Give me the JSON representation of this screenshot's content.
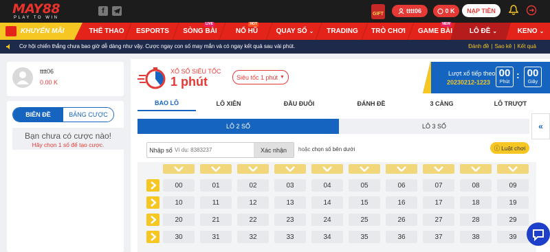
{
  "brand": {
    "name": "MAY88",
    "tagline": "PLAY TO WIN"
  },
  "header": {
    "gift_label": "GIFT",
    "username": "tttt06",
    "balance": "0 K",
    "deposit_label": "NẠP TIỀN"
  },
  "nav": {
    "promo": "KHUYẾN MÃI",
    "items": [
      "THỂ THAO",
      "ESPORTS",
      "SÒNG BÀI",
      "NỔ HŨ",
      "QUAY SỐ",
      "TRADING",
      "TRÒ CHƠI",
      "GAME BÀI",
      "LÔ ĐỀ",
      "KENO"
    ],
    "badges": {
      "live": "LIVE",
      "hot": "HOT",
      "new": "NEW"
    }
  },
  "ticker": {
    "message": "Cơ hội chiến thắng chưa bao giờ dễ dàng như vậy. Cược ngay con số may mắn và có ngay kết quả sau vài phút.",
    "links": [
      "Đánh đề",
      "Sao kê",
      "Kết quả"
    ]
  },
  "user_panel": {
    "username": "tttt06",
    "balance": "0.00 K"
  },
  "slip": {
    "tab_active": "BIÊN ĐỀ",
    "tab_other": "BẢNG CƯỢC",
    "empty_title": "Bạn chưa có cược nào!",
    "empty_hint": "Hãy chọn 1 số để tạo cược."
  },
  "game": {
    "name": "XỔ SỐ SIÊU TỐC",
    "duration": "1 phút",
    "speed_select": "Siêu tốc 1 phút",
    "next_label": "Lượt xổ tiếp theo",
    "draw_id": "20230212-1223",
    "minutes": "00",
    "minutes_unit": "Phút",
    "seconds": "00",
    "seconds_unit": "Giây"
  },
  "bet_tabs": [
    "BAO LÔ",
    "LÔ XIÊN",
    "ĐẦU ĐUÔI",
    "ĐÁNH ĐỀ",
    "3 CÀNG",
    "LÔ TRƯỢT"
  ],
  "sub_tabs": [
    "LÔ 2 SỐ",
    "LÔ 3 SỐ"
  ],
  "number_input": {
    "label": "Nhập số",
    "placeholder": "Ví dụ: 8383237",
    "confirm": "Xác nhận",
    "or_text": "hoặc",
    "pick_text": "chọn số bên dưới"
  },
  "rules_label": "Luật chơi",
  "numbers": [
    [
      "00",
      "01",
      "02",
      "03",
      "04",
      "05",
      "06",
      "07",
      "08",
      "09"
    ],
    [
      "10",
      "11",
      "12",
      "13",
      "14",
      "15",
      "16",
      "17",
      "18",
      "19"
    ],
    [
      "20",
      "21",
      "22",
      "23",
      "24",
      "25",
      "26",
      "27",
      "28",
      "29"
    ],
    [
      "30",
      "31",
      "32",
      "33",
      "34",
      "35",
      "36",
      "37",
      "38",
      "39"
    ]
  ],
  "colors": {
    "primary_red": "#e4241b",
    "accent_yellow": "#f6c623",
    "primary_blue": "#1565c0",
    "dark": "#1c1c1c"
  }
}
